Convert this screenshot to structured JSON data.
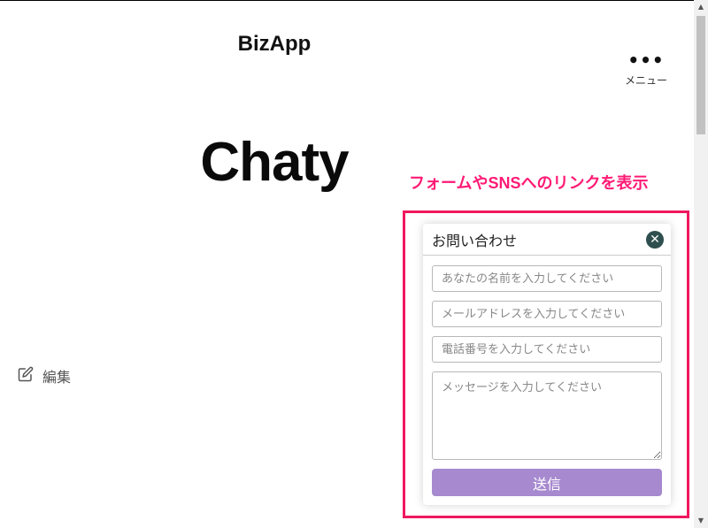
{
  "header": {
    "brand": "BizApp",
    "menu_label": "メニュー",
    "menu_icon": "more-dots-icon"
  },
  "hero": {
    "title": "Chaty"
  },
  "edit": {
    "label": "編集",
    "icon": "edit-icon"
  },
  "annotation": {
    "text": "フォームやSNSへのリンクを表示",
    "color": "#ff1a75"
  },
  "contact_form": {
    "title": "お問い合わせ",
    "close_icon": "close-icon",
    "fields": {
      "name_placeholder": "あなたの名前を入力してください",
      "email_placeholder": "メールアドレスを入力してください",
      "phone_placeholder": "電話番号を入力してください",
      "message_placeholder": "メッセージを入力してください"
    },
    "submit_label": "送信",
    "submit_color": "#a689cf"
  },
  "colors": {
    "highlight_border": "#f0185e",
    "close_button": "#2f4f4f"
  }
}
